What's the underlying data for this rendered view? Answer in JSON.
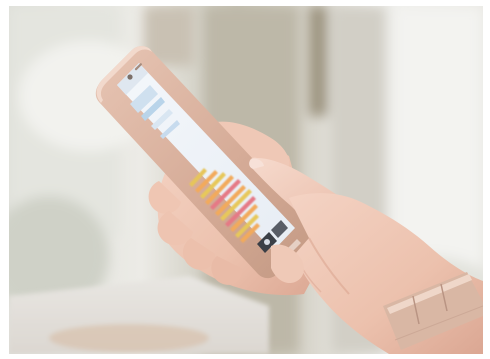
{
  "scene": {
    "subject": "hand-holding-smartphone",
    "phone_color": "#d8b3a2",
    "bracelet_color": "#d9b7a4",
    "background_tones": [
      "#e7e7e5",
      "#b8b4a4",
      "#d4d1c9",
      "#efeeea"
    ],
    "screen_chart_colors": [
      "#f2aa5b",
      "#e7c85a",
      "#e57985",
      "#9ec8e8"
    ]
  }
}
